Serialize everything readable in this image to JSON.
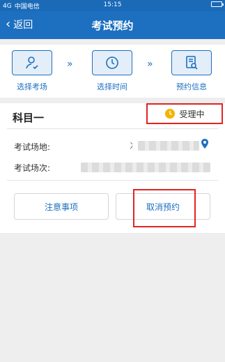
{
  "status_bar": {
    "carrier": "中国电信",
    "signal_text": "4G",
    "time": "15:15"
  },
  "nav": {
    "back_label": "返回",
    "title": "考试预约"
  },
  "steps": [
    {
      "label": "选择考场",
      "icon": "person-check-icon"
    },
    {
      "label": "选择时间",
      "icon": "clock-icon"
    },
    {
      "label": "预约信息",
      "icon": "document-search-icon"
    }
  ],
  "step_arrow": "»",
  "card": {
    "subject": "科目一",
    "status": "受理中",
    "venue_label": "考试场地:",
    "session_label": "考试场次:",
    "venue_value_visible": "冫"
  },
  "buttons": {
    "notice": "注意事项",
    "cancel": "取消预约"
  },
  "colors": {
    "primary": "#1d6fc0",
    "highlight": "#e02424",
    "status_clock": "#f5b400"
  }
}
